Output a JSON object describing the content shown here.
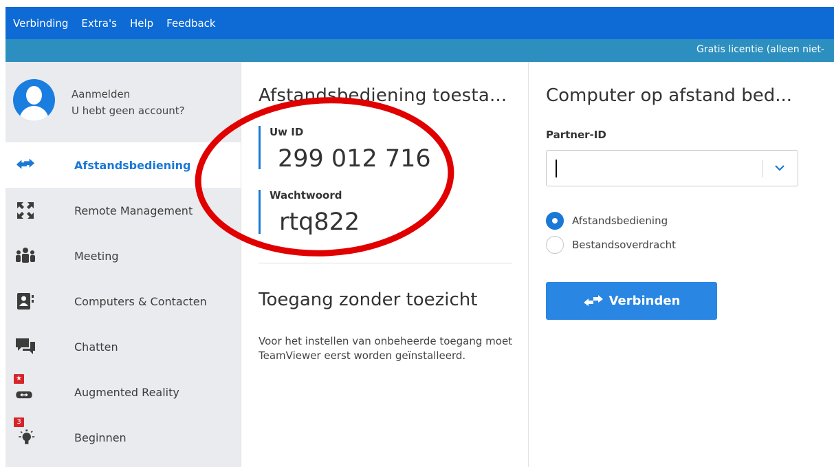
{
  "menu": {
    "items": [
      "Verbinding",
      "Extra's",
      "Help",
      "Feedback"
    ]
  },
  "license": {
    "text": "Gratis licentie (alleen niet-"
  },
  "account": {
    "login": "Aanmelden",
    "no_account": "U hebt geen account?"
  },
  "sidebar": {
    "items": [
      {
        "label": "Afstandsbediening",
        "icon": "arrows-swap-icon",
        "active": true
      },
      {
        "label": "Remote Management",
        "icon": "expand-arrows-icon"
      },
      {
        "label": "Meeting",
        "icon": "group-icon"
      },
      {
        "label": "Computers & Contacten",
        "icon": "contacts-icon"
      },
      {
        "label": "Chatten",
        "icon": "chat-icon"
      },
      {
        "label": "Augmented Reality",
        "icon": "ar-glasses-icon",
        "badge": "★"
      },
      {
        "label": "Beginnen",
        "icon": "lightbulb-icon",
        "badge": "3"
      }
    ]
  },
  "allow_remote": {
    "title": "Afstandsbediening toesta...",
    "id_label": "Uw ID",
    "id_value": "299 012 716",
    "password_label": "Wachtwoord",
    "password_value": "rtq822"
  },
  "unattended": {
    "title": "Toegang zonder toezicht",
    "description": "Voor het instellen van onbeheerde toegang moet TeamViewer eerst worden geïnstalleerd."
  },
  "control_remote": {
    "title": "Computer op afstand bed...",
    "partner_label": "Partner-ID",
    "partner_value": "",
    "options": [
      {
        "label": "Afstandsbediening",
        "selected": true
      },
      {
        "label": "Bestandsoverdracht",
        "selected": false
      }
    ],
    "connect_label": "Verbinden"
  },
  "colors": {
    "menubar": "#0e6ad4",
    "licensebar": "#2d8fbf",
    "accent": "#1a78d6",
    "annotation": "#e00000"
  }
}
